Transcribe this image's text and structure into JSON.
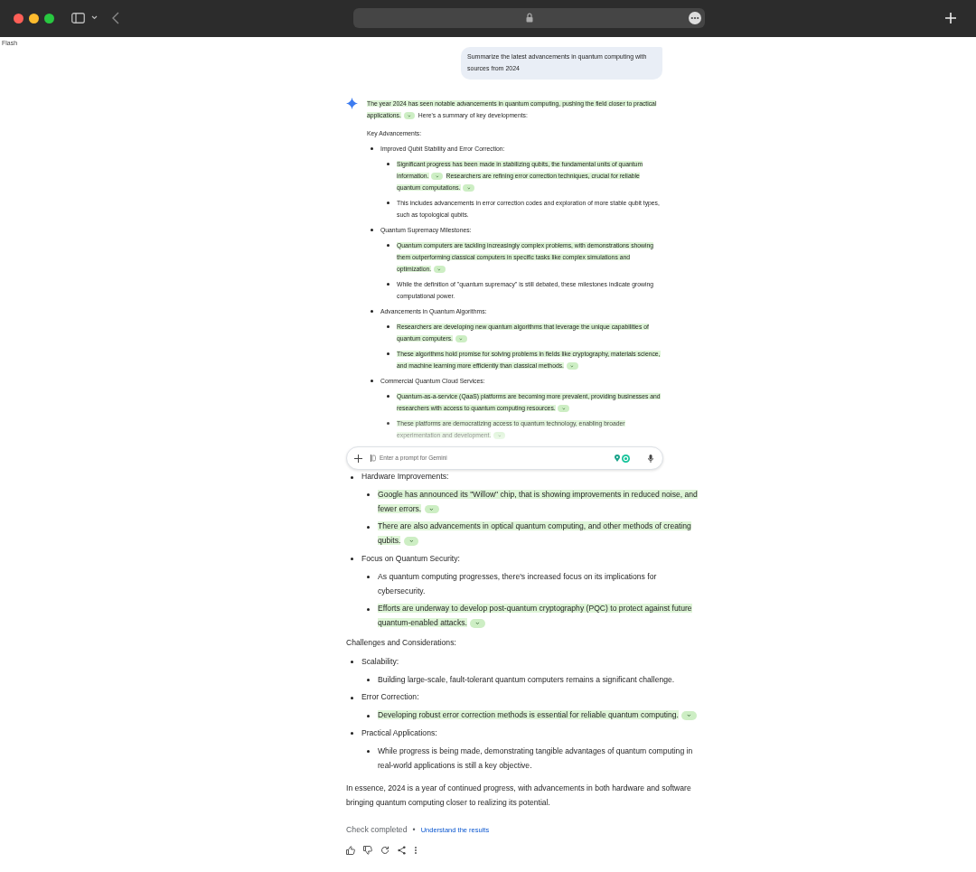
{
  "model_label": "Flash",
  "user_prompt": "Summarize the latest advancements in quantum computing with sources from 2024",
  "top_response": {
    "fades_out": true,
    "intro": [
      {
        "text": "The year 2024 has seen notable advancements in quantum computing, pushing the field closer to practical applications.",
        "verified": true,
        "source_chip": true
      },
      {
        "text": "Here's a summary of key developments:",
        "verified": false,
        "source_chip": false
      }
    ],
    "blocks": [
      {
        "kind": "heading",
        "text": "Key Advancements:"
      },
      {
        "kind": "bullet",
        "text": "Improved Qubit Stability and Error Correction:",
        "children": [
          {
            "kind": "bullet",
            "segments": [
              {
                "text": "Significant progress has been made in stabilizing qubits, the fundamental units of quantum information.",
                "verified": true,
                "source_chip": true
              },
              {
                "text": "Researchers are refining error correction techniques, crucial for reliable quantum computations.",
                "verified": true,
                "source_chip": true
              }
            ]
          },
          {
            "kind": "bullet",
            "text": "This includes advancements in error correction codes and exploration of more stable qubit types, such as topological qubits."
          }
        ]
      },
      {
        "kind": "bullet",
        "text": "Quantum Supremacy Milestones:",
        "children": [
          {
            "kind": "bullet",
            "segments": [
              {
                "text": "Quantum computers are tackling increasingly complex problems, with demonstrations showing them outperforming classical computers in specific tasks like complex simulations and optimization.",
                "verified": true,
                "source_chip": true
              }
            ]
          },
          {
            "kind": "bullet",
            "text": "While the definition of \"quantum supremacy\" is still debated, these milestones indicate growing computational power."
          }
        ]
      },
      {
        "kind": "bullet",
        "text": "Advancements in Quantum Algorithms:",
        "children": [
          {
            "kind": "bullet",
            "segments": [
              {
                "text": "Researchers are developing new quantum algorithms that leverage the unique capabilities of quantum computers.",
                "verified": true,
                "source_chip": true
              }
            ]
          },
          {
            "kind": "bullet",
            "segments": [
              {
                "text": "These algorithms hold promise for solving problems in fields like cryptography, materials science, and machine learning more efficiently than classical methods.",
                "verified": true,
                "source_chip": true
              }
            ]
          }
        ]
      },
      {
        "kind": "bullet",
        "text": "Commercial Quantum Cloud Services:",
        "children": [
          {
            "kind": "bullet",
            "segments": [
              {
                "text": "Quantum-as-a-service (QaaS) platforms are becoming more prevalent, providing businesses and researchers with access to quantum computing resources.",
                "verified": true,
                "source_chip": true
              }
            ]
          },
          {
            "kind": "bullet",
            "segments": [
              {
                "text": "These platforms are democratizing access to quantum technology, enabling broader experimentation and development.",
                "verified": true,
                "source_chip": true
              }
            ]
          }
        ]
      }
    ]
  },
  "prompt_bar": {
    "placeholder": "Enter a prompt for Gemini"
  },
  "bottom_response": {
    "blocks": [
      {
        "kind": "bullet",
        "text": "Hardware Improvements:",
        "children": [
          {
            "kind": "bullet",
            "segments": [
              {
                "text": "Google has announced its \"Willow\" chip, that is showing improvements in reduced noise, and fewer errors.",
                "verified": true,
                "source_chip": true
              }
            ]
          },
          {
            "kind": "bullet",
            "segments": [
              {
                "text": "There are also advancements in optical quantum computing, and other methods of creating qubits.",
                "verified": true,
                "source_chip": true
              }
            ]
          }
        ]
      },
      {
        "kind": "bullet",
        "text": "Focus on Quantum Security:",
        "children": [
          {
            "kind": "bullet",
            "text": "As quantum computing progresses, there's increased focus on its implications for cybersecurity."
          },
          {
            "kind": "bullet",
            "segments": [
              {
                "text": "Efforts are underway to develop post-quantum cryptography (PQC) to protect against future quantum-enabled attacks.",
                "verified": true,
                "source_chip": true
              }
            ]
          }
        ]
      },
      {
        "kind": "heading",
        "text": "Challenges and Considerations:"
      },
      {
        "kind": "bullet",
        "text": "Scalability:",
        "children": [
          {
            "kind": "bullet",
            "text": "Building large-scale, fault-tolerant quantum computers remains a significant challenge."
          }
        ]
      },
      {
        "kind": "bullet",
        "text": "Error Correction:",
        "children": [
          {
            "kind": "bullet",
            "segments": [
              {
                "text": "Developing robust error correction methods is essential for reliable quantum computing.",
                "verified": true,
                "source_chip": true
              }
            ]
          }
        ]
      },
      {
        "kind": "bullet",
        "text": "Practical Applications:",
        "children": [
          {
            "kind": "bullet",
            "text": "While progress is being made, demonstrating tangible advantages of quantum computing in real-world applications is still a key objective."
          }
        ]
      },
      {
        "kind": "paragraph",
        "text": "In essence, 2024 is a year of continued progress, with advancements in both hardware and software bringing quantum computing closer to realizing its potential."
      }
    ]
  },
  "check": {
    "status": "Check completed",
    "separator": "•",
    "link": "Understand the results"
  }
}
